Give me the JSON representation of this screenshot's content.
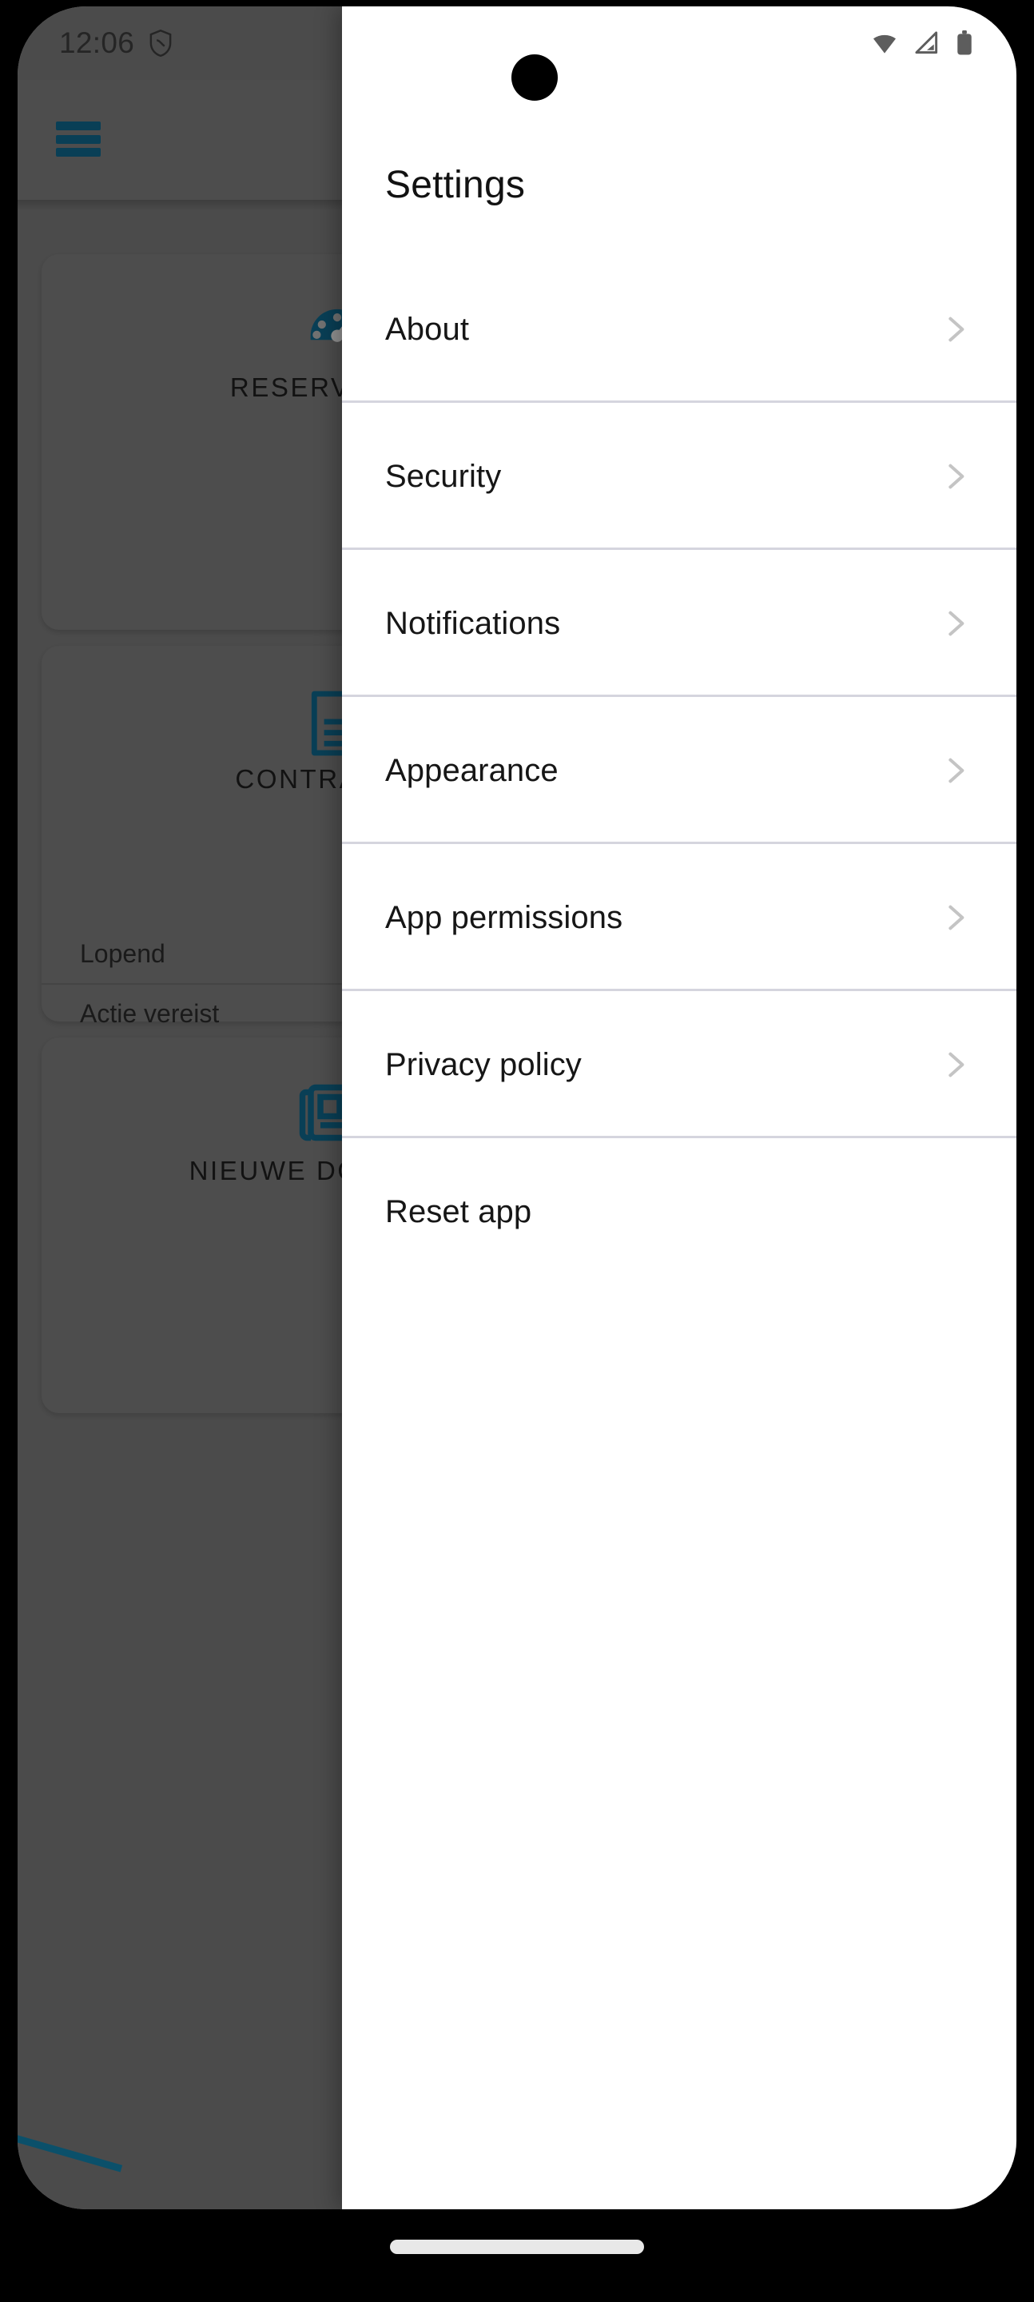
{
  "status_bar": {
    "time": "12:06",
    "shield_icon": "shield-icon",
    "wifi_icon": "wifi-icon",
    "cellular_icon": "cellular-signal-icon",
    "battery_icon": "battery-icon"
  },
  "panel": {
    "title": "Settings",
    "items": [
      {
        "label": "About",
        "chevron": true
      },
      {
        "label": "Security",
        "chevron": true
      },
      {
        "label": "Notifications",
        "chevron": true
      },
      {
        "label": "Appearance",
        "chevron": true
      },
      {
        "label": "App permissions",
        "chevron": true
      },
      {
        "label": "Privacy policy",
        "chevron": true
      },
      {
        "label": "Reset app",
        "chevron": false
      }
    ]
  },
  "background_app": {
    "menu_icon": "hamburger-menu-icon",
    "cards": [
      {
        "label": "RESERVERING",
        "icon": "gauge-icon"
      },
      {
        "label": "CONTRACTEN",
        "icon": "document-icon"
      },
      {
        "label": "NIEUWE DOCUMENT",
        "icon": "newspaper-icon"
      }
    ],
    "status_rows": [
      "Lopend",
      "Actie vereist"
    ]
  },
  "colors": {
    "accent": "#10678b",
    "panel_bg": "#ffffff",
    "divider": "#d5d5de",
    "scrim": "rgba(0,0,0,0.38)",
    "text_primary": "#161616",
    "chevron": "#c4c4c4"
  }
}
